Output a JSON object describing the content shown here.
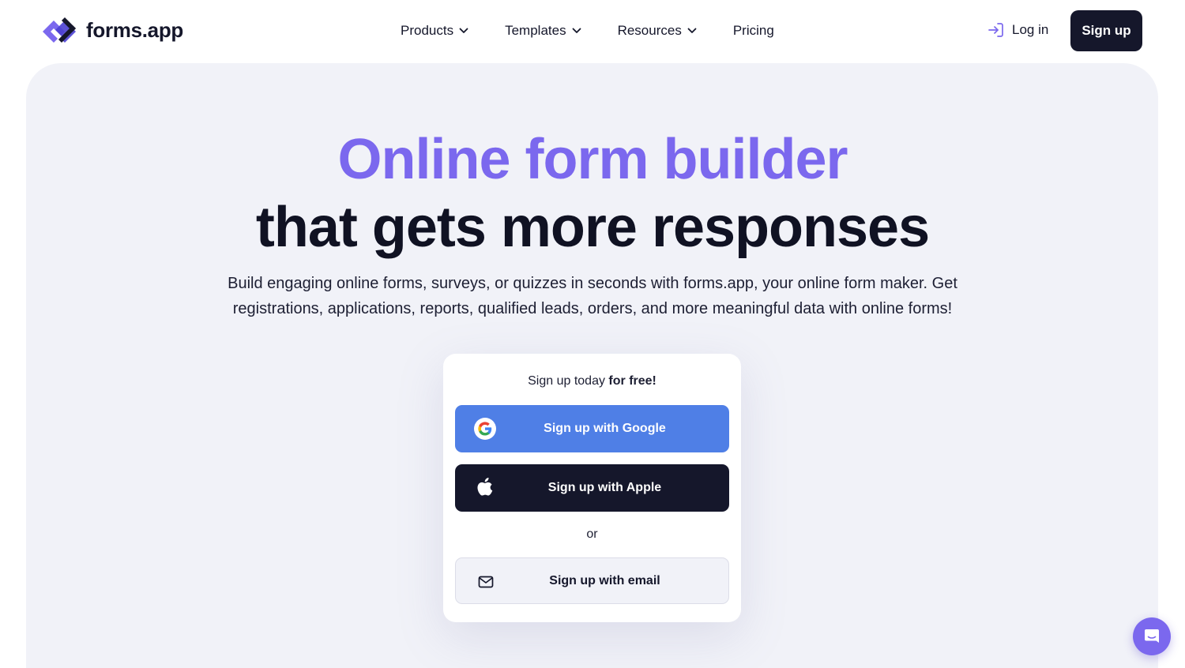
{
  "header": {
    "logo_text": "forms.app",
    "nav": [
      {
        "label": "Products",
        "has_dropdown": true
      },
      {
        "label": "Templates",
        "has_dropdown": true
      },
      {
        "label": "Resources",
        "has_dropdown": true
      },
      {
        "label": "Pricing",
        "has_dropdown": false
      }
    ],
    "login_label": "Log in",
    "signup_label": "Sign up"
  },
  "hero": {
    "title_line1": "Online form builder",
    "title_line2": "that gets more responses",
    "description": "Build engaging online forms, surveys, or quizzes in seconds with forms.app, your online form maker. Get registrations, applications, reports, qualified leads, orders, and more meaningful data with online forms!"
  },
  "signup_card": {
    "title_prefix": "Sign up today ",
    "title_bold": "for free!",
    "google_label": "Sign up with Google",
    "apple_label": "Sign up with Apple",
    "or_label": "or",
    "email_label": "Sign up with email"
  },
  "icons": {
    "logo": "forms-app-logo-icon",
    "chevron": "chevron-down-icon",
    "login": "login-arrow-icon",
    "google": "google-icon",
    "apple": "apple-icon",
    "email": "envelope-icon",
    "chat": "chat-bubble-icon"
  },
  "colors": {
    "accent": "#7b68ee",
    "dark": "#15172b",
    "google_button": "#4f7fe6",
    "hero_background": "#f1f2f8"
  }
}
